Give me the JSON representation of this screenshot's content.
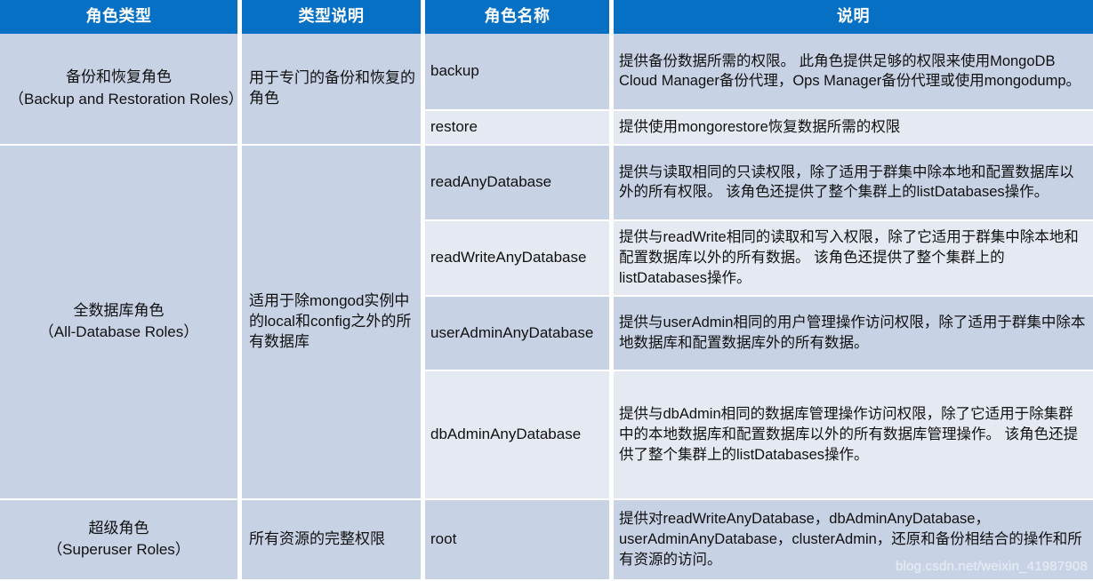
{
  "table": {
    "columns": [
      {
        "key": "role_type",
        "label": "角色类型"
      },
      {
        "key": "type_desc",
        "label": "类型说明"
      },
      {
        "key": "role_name",
        "label": "角色名称"
      },
      {
        "key": "description",
        "label": "说明"
      }
    ],
    "categories": [
      {
        "name_cn": "备份和恢复角色",
        "name_en": "（Backup and Restoration Roles）",
        "type_desc": "用于专门的备份和恢复的角色",
        "rows": [
          {
            "role_name": "backup",
            "description": "提供备份数据所需的权限。 此角色提供足够的权限来使用MongoDB Cloud Manager备份代理，Ops Manager备份代理或使用mongodump。"
          },
          {
            "role_name": "restore",
            "description": "提供使用mongorestore恢复数据所需的权限"
          }
        ]
      },
      {
        "name_cn": "全数据库角色",
        "name_en": "（All-Database Roles）",
        "type_desc": "适用于除mongod实例中的local和config之外的所有数据库",
        "rows": [
          {
            "role_name": "readAnyDatabase",
            "description": "提供与读取相同的只读权限，除了适用于群集中除本地和配置数据库以外的所有权限。 该角色还提供了整个集群上的listDatabases操作。"
          },
          {
            "role_name": "readWriteAnyDatabase",
            "description": "提供与readWrite相同的读取和写入权限，除了它适用于群集中除本地和配置数据库以外的所有数据。 该角色还提供了整个集群上的listDatabases操作。"
          },
          {
            "role_name": "userAdminAnyDatabase",
            "description": "提供与userAdmin相同的用户管理操作访问权限，除了适用于群集中除本地数据库和配置数据库外的所有数据。"
          },
          {
            "role_name": "dbAdminAnyDatabase",
            "description": "提供与dbAdmin相同的数据库管理操作访问权限，除了它适用于除集群中的本地数据库和配置数据库以外的所有数据库管理操作。 该角色还提供了整个集群上的listDatabases操作。"
          }
        ]
      },
      {
        "name_cn": "超级角色",
        "name_en": "（Superuser Roles）",
        "type_desc": "所有资源的完整权限",
        "rows": [
          {
            "role_name": "root",
            "description": "提供对readWriteAnyDatabase，dbAdminAnyDatabase，userAdminAnyDatabase，clusterAdmin，还原和备份相结合的操作和所有资源的访问。"
          }
        ]
      }
    ]
  },
  "watermark": {
    "text": "blog.csdn.net/weixin_41987908"
  },
  "colors": {
    "header_blue": "#0670c4",
    "band_dark": "#c7d2e5",
    "band_light": "#e4e9f2",
    "grid_white": "#ffffff",
    "text": "#111111",
    "watermark": "#e9eef5"
  }
}
